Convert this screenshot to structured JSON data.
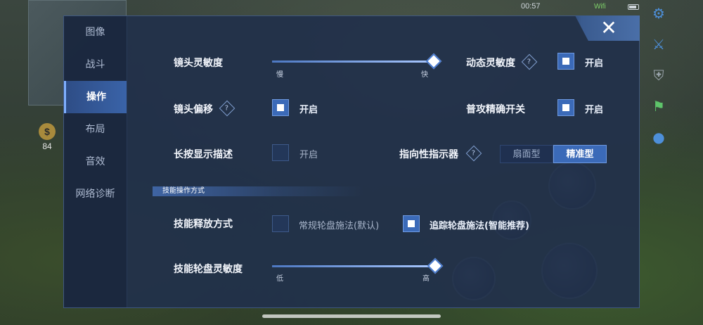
{
  "status": {
    "time": "00:57",
    "wifi": "Wifi"
  },
  "hud": {
    "gold_icon_glyph": "$",
    "gold_value": "84"
  },
  "tabs": [
    {
      "label": "图像",
      "active": false
    },
    {
      "label": "战斗",
      "active": false
    },
    {
      "label": "操作",
      "active": true
    },
    {
      "label": "布局",
      "active": false
    },
    {
      "label": "音效",
      "active": false
    },
    {
      "label": "网络诊断",
      "active": false
    }
  ],
  "close_glyph": "✕",
  "help_glyph": "?",
  "settings": {
    "camera_sensitivity": {
      "label": "镜头灵敏度",
      "min_label": "慢",
      "max_label": "快",
      "value": 1.0
    },
    "dynamic_sensitivity": {
      "label": "动态灵敏度",
      "checkbox_label": "开启",
      "checked": true
    },
    "camera_offset": {
      "label": "镜头偏移",
      "checkbox_label": "开启",
      "checked": true
    },
    "precise_attack": {
      "label": "普攻精确开关",
      "checkbox_label": "开启",
      "checked": true
    },
    "long_press_desc": {
      "label": "长按显示描述",
      "checkbox_label": "开启",
      "checked": false
    },
    "direction_indicator": {
      "label": "指向性指示器",
      "options": [
        "扇面型",
        "精准型"
      ],
      "selected": "精准型"
    }
  },
  "skill_section": {
    "title": "技能操作方式",
    "cast_mode": {
      "label": "技能释放方式",
      "option_normal": "常规轮盘施法(默认)",
      "option_normal_checked": false,
      "option_tracking": "追踪轮盘施法(智能推荐)",
      "option_tracking_checked": true
    },
    "wheel_sensitivity": {
      "label": "技能轮盘灵敏度",
      "min_label": "低",
      "max_label": "高",
      "value": 1.0
    }
  }
}
